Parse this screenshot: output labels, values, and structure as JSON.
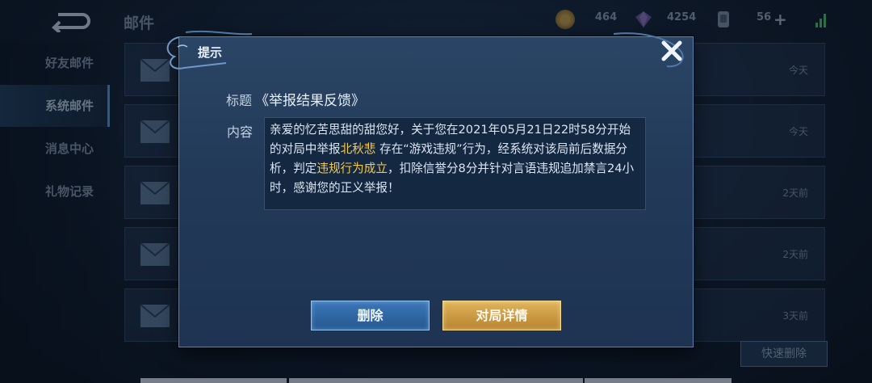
{
  "header": {
    "title": "邮件",
    "coins": "464",
    "diamonds": "4254",
    "tickets": "56"
  },
  "sidebar": {
    "items": [
      {
        "label": "好友邮件"
      },
      {
        "label": "系统邮件"
      },
      {
        "label": "消息中心"
      },
      {
        "label": "礼物记录"
      }
    ],
    "active_index": 1
  },
  "mail_list": {
    "rows": [
      {
        "time": "今天"
      },
      {
        "time": "今天"
      },
      {
        "time": "2天前"
      },
      {
        "time": "2天前"
      },
      {
        "time": "3天前"
      }
    ],
    "quick_delete_label": "快速删除"
  },
  "dialog": {
    "title": "提示",
    "subject_label": "标题",
    "subject": "《举报结果反馈》",
    "content_label": "内容",
    "content_parts": {
      "p1": "亲爱的忆苦思甜的甜您好，关于您在2021年05月21日22时58分开始的对局中举报",
      "player": "北秋悲",
      "p2": " 存在“游戏违规”行为，经系统对该局前后数据分析，判定",
      "verdict": "违规行为成立",
      "p3": "，扣除信誉分8分并针对言语违规追加禁言24小时，感谢您的正义举报！"
    },
    "delete_label": "删除",
    "detail_label": "对局详情"
  },
  "colors": {
    "highlight": "#f2c94c",
    "delete_button": "#2f6aa8",
    "detail_button": "#d4a54a"
  }
}
